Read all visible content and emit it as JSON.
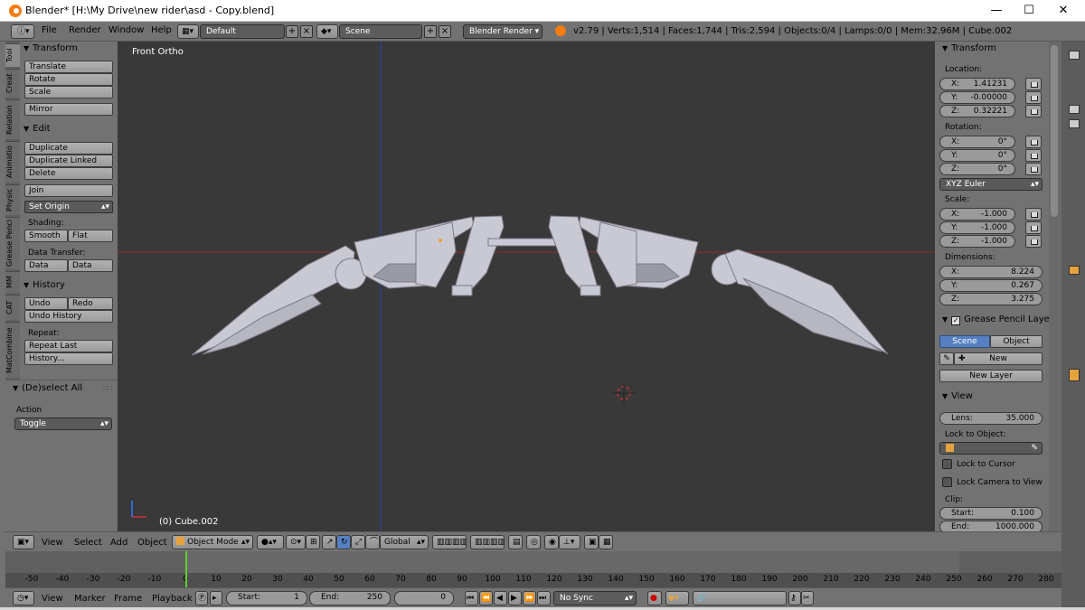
{
  "window": {
    "title": "Blender* [H:\\My Drive\\new rider\\asd - Copy.blend]",
    "minimize": "—",
    "maximize": "☐",
    "close": "✕"
  },
  "topbar": {
    "menus": [
      "File",
      "Render",
      "Window",
      "Help"
    ],
    "layout": "Default",
    "scene": "Scene",
    "engine": "Blender Render",
    "stats": "v2.79 | Verts:1,514 | Faces:1,744 | Tris:2,594 | Objects:0/4 | Lamps:0/0 | Mem:32.96M | Cube.002"
  },
  "tabs": [
    "Tool",
    "Creat",
    "Relation",
    "Animatio",
    "Physic",
    "Grease Penci",
    "MM",
    "CAT",
    "MatCombine"
  ],
  "toolshelf": {
    "transform_header": "Transform",
    "translate": "Translate",
    "rotate": "Rotate",
    "scale": "Scale",
    "mirror": "Mirror",
    "edit_header": "Edit",
    "duplicate": "Duplicate",
    "duplicate_linked": "Duplicate Linked",
    "delete": "Delete",
    "join": "Join",
    "set_origin": "Set Origin",
    "shading_label": "Shading:",
    "smooth": "Smooth",
    "flat": "Flat",
    "data_transfer_label": "Data Transfer:",
    "data": "Data",
    "data_layo": "Data Layo",
    "history_header": "History",
    "undo": "Undo",
    "redo": "Redo",
    "undo_history": "Undo History",
    "repeat_label": "Repeat:",
    "repeat_last": "Repeat Last",
    "history_btn": "History..."
  },
  "redo_panel": {
    "header": "(De)select All",
    "action_label": "Action",
    "action_value": "Toggle"
  },
  "viewport": {
    "label": "Front Ortho",
    "object": "(0) Cube.002"
  },
  "properties": {
    "transform_header": "Transform",
    "location_label": "Location:",
    "location": [
      {
        "k": "X:",
        "v": "1.41231"
      },
      {
        "k": "Y:",
        "v": "-0.00000"
      },
      {
        "k": "Z:",
        "v": "0.32221"
      }
    ],
    "rotation_label": "Rotation:",
    "rotation": [
      {
        "k": "X:",
        "v": "0°"
      },
      {
        "k": "Y:",
        "v": "0°"
      },
      {
        "k": "Z:",
        "v": "0°"
      }
    ],
    "rotation_mode": "XYZ Euler",
    "scale_label": "Scale:",
    "scale": [
      {
        "k": "X:",
        "v": "-1.000"
      },
      {
        "k": "Y:",
        "v": "-1.000"
      },
      {
        "k": "Z:",
        "v": "-1.000"
      }
    ],
    "dimensions_label": "Dimensions:",
    "dimensions": [
      {
        "k": "X:",
        "v": "8.224"
      },
      {
        "k": "Y:",
        "v": "0.267"
      },
      {
        "k": "Z:",
        "v": "3.275"
      }
    ],
    "gp_header": "Grease Pencil Layer",
    "gp_scene": "Scene",
    "gp_object": "Object",
    "gp_new": "New",
    "gp_new_layer": "New Layer",
    "view_header": "View",
    "lens_label": "Lens:",
    "lens_value": "35.000",
    "lock_object_label": "Lock to Object:",
    "lock_cursor": "Lock to Cursor",
    "lock_camera": "Lock Camera to View",
    "clip_label": "Clip:",
    "clip_start_k": "Start:",
    "clip_start_v": "0.100",
    "clip_end_k": "End:",
    "clip_end_v": "1000.000"
  },
  "view_header": {
    "view": "View",
    "select": "Select",
    "add": "Add",
    "object": "Object",
    "mode": "Object Mode",
    "orientation": "Global"
  },
  "timeline": {
    "ticks": [
      "-50",
      "-40",
      "-30",
      "-20",
      "-10",
      "0",
      "10",
      "20",
      "30",
      "40",
      "50",
      "60",
      "70",
      "80",
      "90",
      "100",
      "110",
      "120",
      "130",
      "140",
      "150",
      "160",
      "170",
      "180",
      "190",
      "200",
      "210",
      "220",
      "230",
      "240",
      "250",
      "260",
      "270",
      "280"
    ],
    "view": "View",
    "marker": "Marker",
    "frame": "Frame",
    "playback": "Playback",
    "start_label": "Start:",
    "start_value": "1",
    "end_label": "End:",
    "end_value": "250",
    "current": "0",
    "sync": "No Sync"
  },
  "colors": {
    "accent": "#5680c2",
    "viewport_bg": "#393939",
    "current_frame": "#5fcf33",
    "x_axis": "#9b2f2f",
    "z_axis": "#2f3fa6"
  }
}
